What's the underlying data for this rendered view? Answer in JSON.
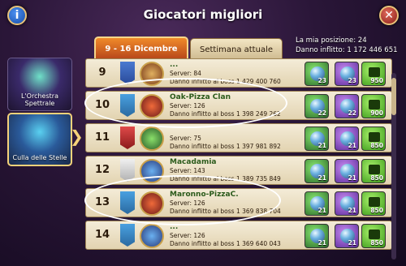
{
  "header": {
    "title": "Giocatori migliori"
  },
  "tabs": [
    {
      "label": "9 - 16 Dicembre",
      "active": true
    },
    {
      "label": "Settimana attuale",
      "active": false
    }
  ],
  "my_position": {
    "position_line": "La mia posizione: 24",
    "damage_line": "Danno inflitto: 1 172 446 651"
  },
  "sidebar": {
    "items": [
      {
        "label": "L'Orchestra Spettrale"
      },
      {
        "label": "Culla delle Stelle"
      }
    ]
  },
  "rows": [
    {
      "rank": "9",
      "name": "...",
      "server": "Server: 84",
      "damage": "Danno inflitto al boss 1 429 400 760",
      "c1": "23",
      "c2": "23",
      "c3": "950"
    },
    {
      "rank": "10",
      "name": "Oak-Pizza Clan",
      "server": "Server: 126",
      "damage": "Danno inflitto al boss 1 398 249 262",
      "c1": "22",
      "c2": "22",
      "c3": "900"
    },
    {
      "rank": "11",
      "name": "",
      "server": "Server: 75",
      "damage": "Danno inflitto al boss 1 397 981 892",
      "c1": "21",
      "c2": "21",
      "c3": "850"
    },
    {
      "rank": "12",
      "name": "Macadamia",
      "server": "Server: 143",
      "damage": "Danno inflitto al boss 1 389 735 849",
      "c1": "21",
      "c2": "21",
      "c3": "850"
    },
    {
      "rank": "13",
      "name": "Maronno-PizzaC.",
      "server": "Server: 126",
      "damage": "Danno inflitto al boss 1 369 838 704",
      "c1": "21",
      "c2": "21",
      "c3": "850"
    },
    {
      "rank": "14",
      "name": "...",
      "server": "Server: 126",
      "damage": "Danno inflitto al boss 1 369 640 043",
      "c1": "21",
      "c2": "21",
      "c3": "850"
    }
  ],
  "colors": {
    "tab_active": "#d0641e",
    "row_bg": "#efe4cb",
    "name_green": "#2a5a1a"
  }
}
